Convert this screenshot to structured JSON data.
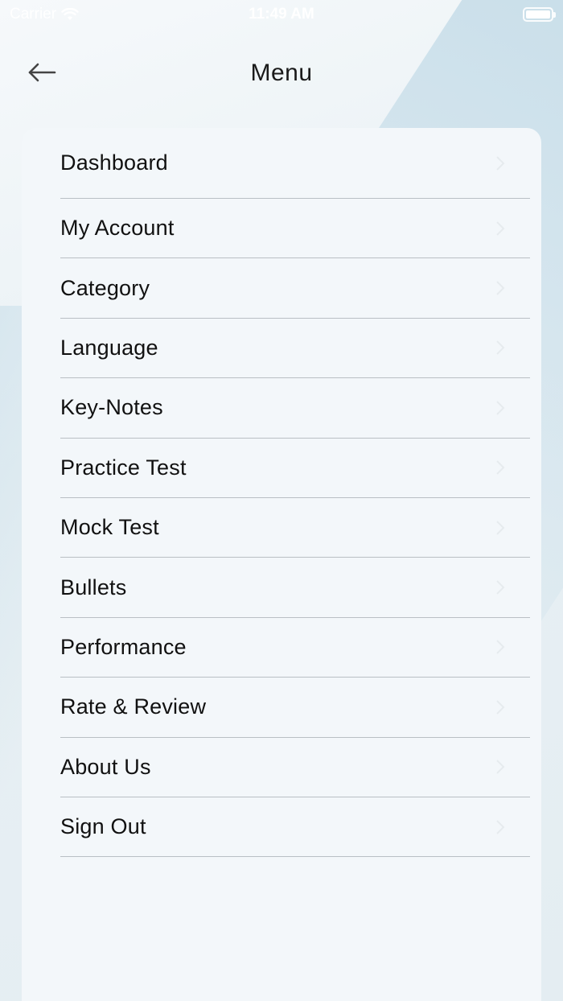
{
  "status_bar": {
    "carrier": "Carrier",
    "time": "11:49 AM"
  },
  "header": {
    "title": "Menu",
    "back_icon": "arrow-left-icon"
  },
  "menu": {
    "items": [
      {
        "label": "Dashboard"
      },
      {
        "label": "My Account"
      },
      {
        "label": "Category"
      },
      {
        "label": "Language"
      },
      {
        "label": "Key-Notes"
      },
      {
        "label": "Practice Test"
      },
      {
        "label": "Mock Test"
      },
      {
        "label": "Bullets"
      },
      {
        "label": "Performance"
      },
      {
        "label": "Rate & Review"
      },
      {
        "label": "About Us"
      },
      {
        "label": "Sign Out"
      }
    ],
    "chevron_icon": "chevron-right-icon"
  },
  "colors": {
    "card_background": "#f3f7fa",
    "divider": "#b9bfc4",
    "text": "#111111"
  }
}
